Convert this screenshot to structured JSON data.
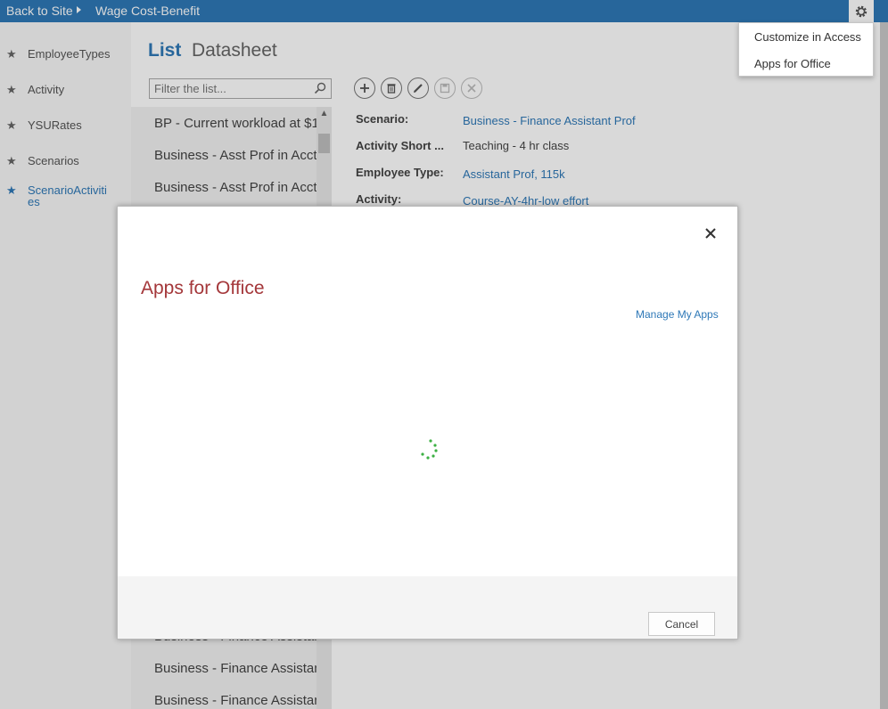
{
  "topbar": {
    "back_label": "Back to Site",
    "app_title": "Wage Cost-Benefit",
    "settings_icon": "gear-icon"
  },
  "settings_menu": {
    "items": [
      "Customize in Access",
      "Apps for Office"
    ]
  },
  "nav": {
    "items": [
      {
        "label": "EmployeeTypes",
        "active": false
      },
      {
        "label": "Activity",
        "active": false
      },
      {
        "label": "YSURates",
        "active": false
      },
      {
        "label": "Scenarios",
        "active": false
      },
      {
        "label": "ScenarioActivities",
        "active": true
      }
    ],
    "item_icon": "star-icon"
  },
  "view_tabs": {
    "list": "List",
    "datasheet": "Datasheet"
  },
  "filter": {
    "placeholder": "Filter the list..."
  },
  "list": {
    "items": [
      "BP - Current workload at $1",
      "Business - Asst Prof in Acctg",
      "Business - Asst Prof in Acctg",
      "Business - Finance Assistant",
      "Business - Finance Assistant",
      "Business - Finance Assistant"
    ]
  },
  "toolbar": {
    "buttons": [
      {
        "icon": "add-icon",
        "enabled": true
      },
      {
        "icon": "delete-icon",
        "enabled": true
      },
      {
        "icon": "edit-icon",
        "enabled": true
      },
      {
        "icon": "save-icon",
        "enabled": false
      },
      {
        "icon": "cancel-icon",
        "enabled": false
      }
    ]
  },
  "detail": {
    "fields": [
      {
        "label": "Scenario:",
        "value": "Business - Finance Assistant Prof",
        "link": true
      },
      {
        "label": "Activity Short ...",
        "value": "Teaching - 4 hr class",
        "link": false
      },
      {
        "label": "Employee Type:",
        "value": "Assistant Prof, 115k",
        "link": true
      },
      {
        "label": "Activity:",
        "value": "Course-AY-4hr-low effort",
        "link": true
      }
    ]
  },
  "dialog": {
    "title": "Apps for Office",
    "manage_link": "Manage My Apps",
    "cancel_label": "Cancel",
    "close_icon": "close-icon",
    "loading_icon": "loading-spinner-icon"
  },
  "colors": {
    "accent": "#2e78b7",
    "dialog_title": "#a4373a",
    "spinner": "#3cb043"
  }
}
